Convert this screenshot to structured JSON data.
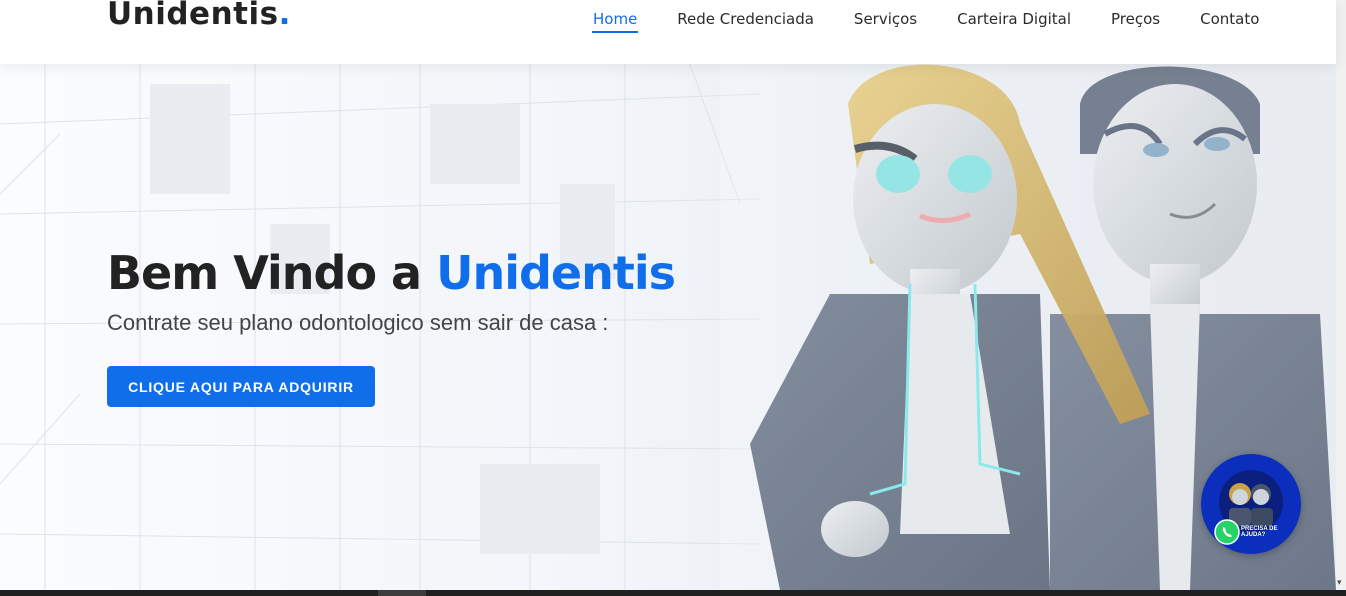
{
  "header": {
    "logo_text": "Unidentis",
    "logo_dot": ".",
    "nav": [
      {
        "label": "Home",
        "active": true
      },
      {
        "label": "Rede Credenciada"
      },
      {
        "label": "Serviços"
      },
      {
        "label": "Carteira Digital"
      },
      {
        "label": "Preços"
      },
      {
        "label": "Contato"
      }
    ]
  },
  "hero": {
    "title_prefix": "Bem Vindo a ",
    "title_brand": "Unidentis",
    "subtitle": "Contrate seu plano odontologico sem sair de casa :",
    "cta_label": "CLIQUE AQUI PARA ADQUIRIR"
  },
  "help_widget": {
    "line1": "PRECISA DE",
    "line2": "AJUDA?",
    "icon": "whatsapp-icon"
  },
  "colors": {
    "accent": "#106eea",
    "text_dark": "#222222",
    "widget_bg": "#0b2ebd",
    "whatsapp": "#25d366"
  }
}
